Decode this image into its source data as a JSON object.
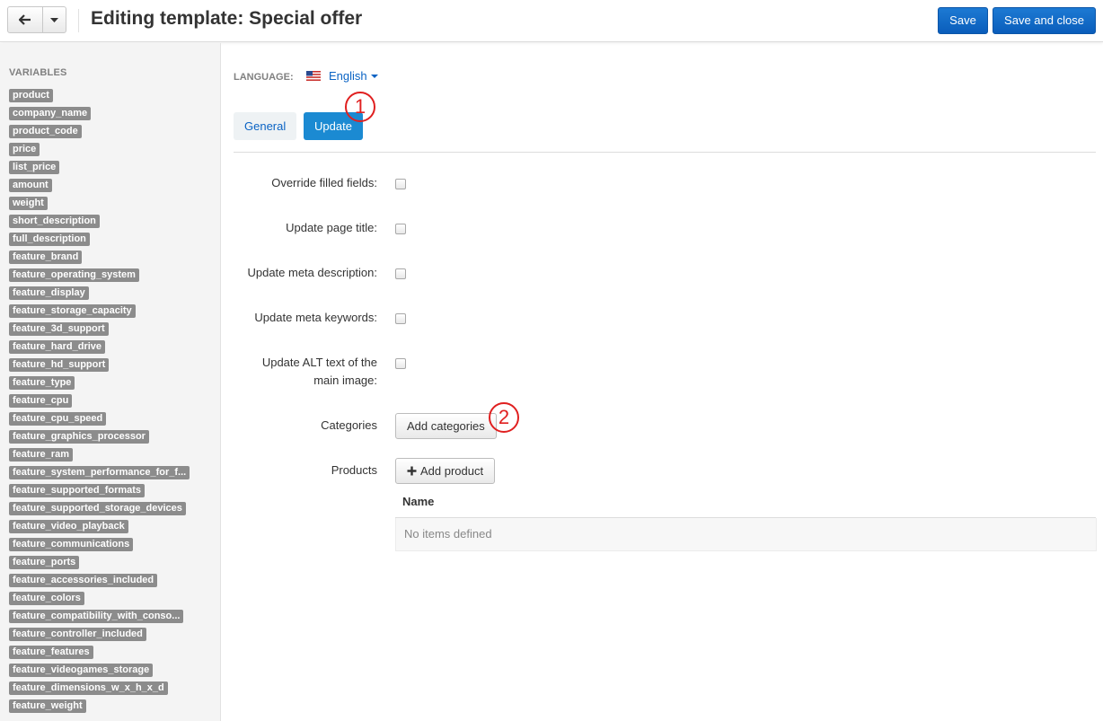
{
  "header": {
    "title": "Editing template: Special offer",
    "save_label": "Save",
    "save_close_label": "Save and close"
  },
  "sidebar": {
    "title": "VARIABLES",
    "variables": [
      "product",
      "company_name",
      "product_code",
      "price",
      "list_price",
      "amount",
      "weight",
      "short_description",
      "full_description",
      "feature_brand",
      "feature_operating_system",
      "feature_display",
      "feature_storage_capacity",
      "feature_3d_support",
      "feature_hard_drive",
      "feature_hd_support",
      "feature_type",
      "feature_cpu",
      "feature_cpu_speed",
      "feature_graphics_processor",
      "feature_ram",
      "feature_system_performance_for_f...",
      "feature_supported_formats",
      "feature_supported_storage_devices",
      "feature_video_playback",
      "feature_communications",
      "feature_ports",
      "feature_accessories_included",
      "feature_colors",
      "feature_compatibility_with_conso...",
      "feature_controller_included",
      "feature_features",
      "feature_videogames_storage",
      "feature_dimensions_w_x_h_x_d",
      "feature_weight"
    ]
  },
  "language": {
    "label": "LANGUAGE:",
    "value": "English",
    "flag_icon": "us-flag-icon"
  },
  "tabs": {
    "general": "General",
    "update": "Update",
    "active": "Update"
  },
  "annotations": {
    "first": "1",
    "second": "2",
    "color": "#e02020"
  },
  "form": {
    "override_filled": "Override filled fields:",
    "update_page_title": "Update page title:",
    "update_meta_description": "Update meta description:",
    "update_meta_keywords": "Update meta keywords:",
    "update_alt_text_line1": "Update ALT text of the",
    "update_alt_text_line2": "main image:",
    "categories_label": "Categories",
    "add_categories": "Add categories",
    "products_label": "Products",
    "add_product": "Add product"
  },
  "products_table": {
    "column_name": "Name",
    "empty_text": "No items defined"
  },
  "colors": {
    "primary": "#0a63c4",
    "active_tab": "#1b8ad2",
    "variable_tag": "#8c8c8c"
  }
}
